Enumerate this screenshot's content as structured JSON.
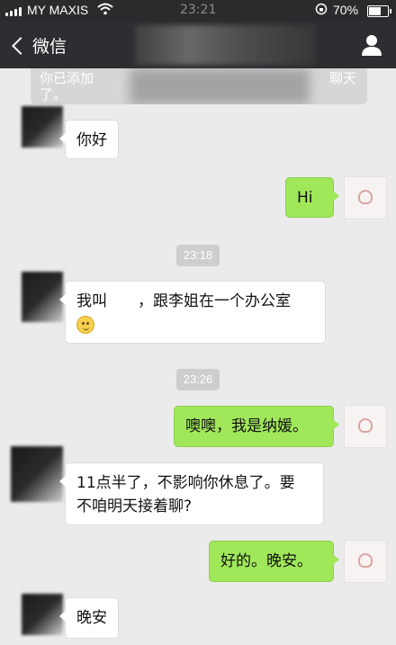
{
  "status_bar": {
    "carrier": "MY MAXIS",
    "time": "23:21",
    "battery": "70%",
    "battery_level": 0.7
  },
  "nav": {
    "back_label": "微信"
  },
  "system_notice": {
    "text_line1": "你已添加",
    "text_line1_end": "聊天",
    "text_line2": "了。"
  },
  "messages": [
    {
      "side": "left",
      "text": "你好"
    },
    {
      "side": "right",
      "text": "Hi"
    },
    {
      "timestamp": "23:18"
    },
    {
      "side": "left",
      "text_line1": "我叫　　，跟李姐在一个办公室",
      "emoji": "smile-emoji"
    },
    {
      "timestamp": "23:26"
    },
    {
      "side": "right",
      "text": "噢噢，我是纳媛。"
    },
    {
      "side": "left",
      "text_line1": "11点半了，不影响你休息了。要",
      "text_line2": "不咱明天接着聊?"
    },
    {
      "side": "right",
      "text": "好的。晚安。"
    },
    {
      "side": "left",
      "text": "晚安"
    }
  ],
  "colors": {
    "outgoing_bubble": "#a0e75a",
    "incoming_bubble": "#ffffff",
    "background": "#ebebeb",
    "nav_bar": "#2e2e32"
  }
}
